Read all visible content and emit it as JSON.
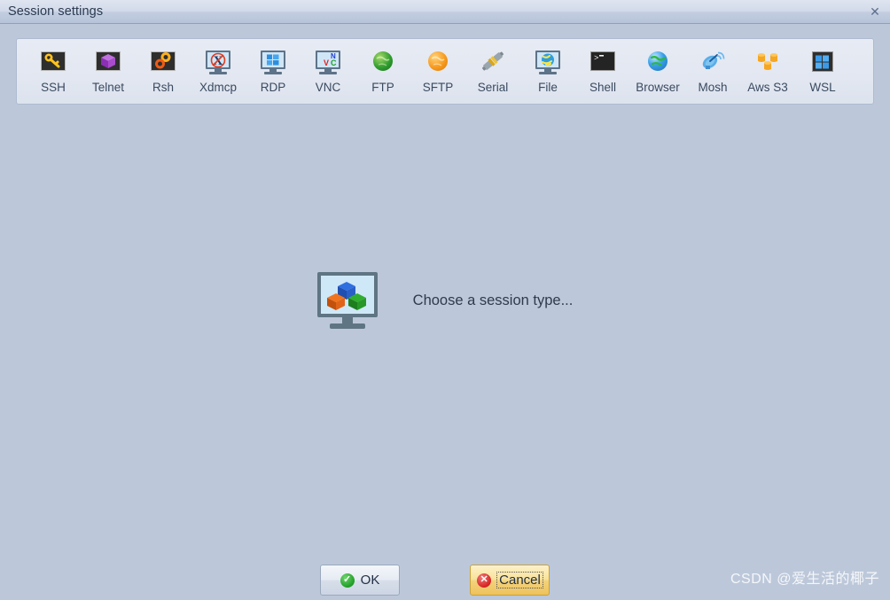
{
  "window": {
    "title": "Session settings",
    "close_label": "✕"
  },
  "colors": {
    "background": "#bcc8da",
    "toolbar_bg": "#e2e7f1",
    "titlebar_top": "#dfe5f0",
    "titlebar_bottom": "#b6c3d9",
    "label_text": "#3a4a60",
    "accent_focus": "#f3d37d",
    "ok_green": "#1f9e26",
    "cancel_red": "#d62222"
  },
  "toolbar": {
    "items": [
      {
        "label": "SSH",
        "icon": "key-icon"
      },
      {
        "label": "Telnet",
        "icon": "purple-cube-icon"
      },
      {
        "label": "Rsh",
        "icon": "gears-icon"
      },
      {
        "label": "Xdmcp",
        "icon": "x-monitor-icon"
      },
      {
        "label": "RDP",
        "icon": "windows-monitor-icon"
      },
      {
        "label": "VNC",
        "icon": "vnc-monitor-icon"
      },
      {
        "label": "FTP",
        "icon": "green-globe-icon"
      },
      {
        "label": "SFTP",
        "icon": "orange-globe-icon"
      },
      {
        "label": "Serial",
        "icon": "serial-plug-icon"
      },
      {
        "label": "File",
        "icon": "globe-monitor-icon"
      },
      {
        "label": "Shell",
        "icon": "terminal-icon"
      },
      {
        "label": "Browser",
        "icon": "blue-globe-icon"
      },
      {
        "label": "Mosh",
        "icon": "satellite-dish-icon"
      },
      {
        "label": "Aws S3",
        "icon": "aws-buckets-icon"
      },
      {
        "label": "WSL",
        "icon": "windows-tile-icon"
      }
    ]
  },
  "main": {
    "placeholder_text": "Choose a session type...",
    "placeholder_icon": "monitor-cubes-icon"
  },
  "footer": {
    "ok_label": "OK",
    "cancel_label": "Cancel",
    "ok_icon": "check-circle-icon",
    "cancel_icon": "cross-circle-icon",
    "focused_button": "Cancel"
  },
  "watermark": {
    "text": "CSDN @爱生活的椰子"
  }
}
